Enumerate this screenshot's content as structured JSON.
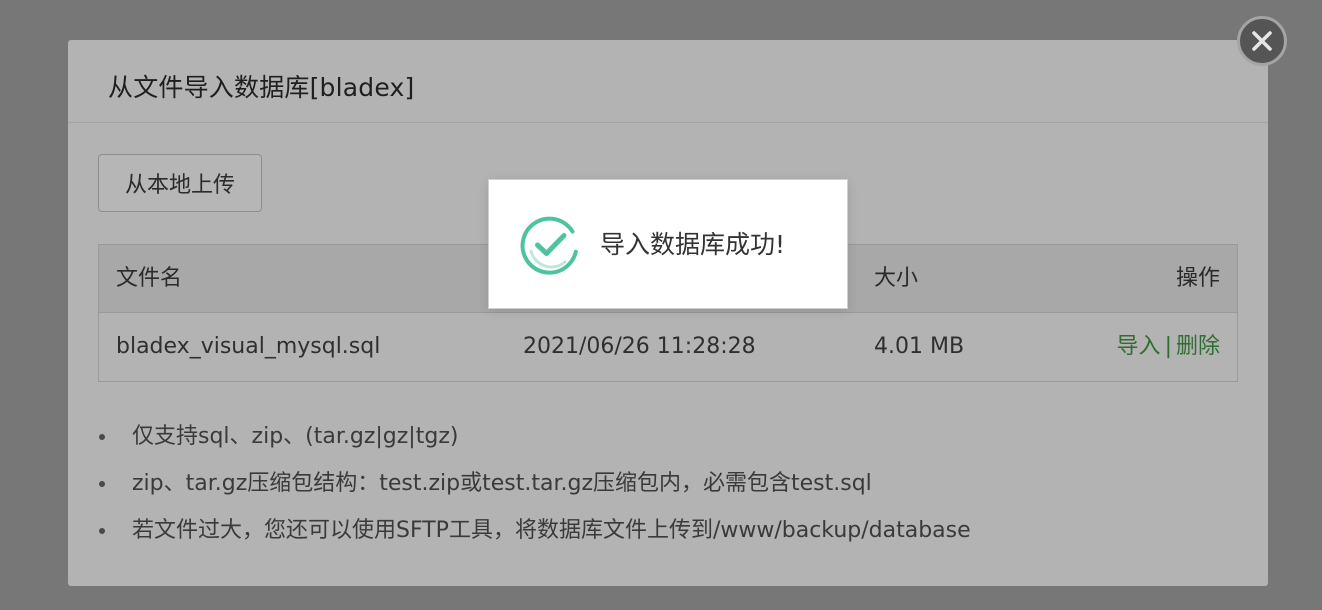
{
  "dialog": {
    "title": "从文件导入数据库[bladex]",
    "upload_label": "从本地上传"
  },
  "table": {
    "headers": {
      "name": "文件名",
      "size": "大小",
      "ops": "操作"
    },
    "rows": [
      {
        "name": "bladex_visual_mysql.sql",
        "time": "2021/06/26 11:28:28",
        "size": "4.01 MB",
        "import_label": "导入",
        "separator": "|",
        "delete_label": "删除"
      }
    ]
  },
  "tips": [
    "仅支持sql、zip、(tar.gz|gz|tgz)",
    "zip、tar.gz压缩包结构：test.zip或test.tar.gz压缩包内，必需包含test.sql",
    "若文件过大，您还可以使用SFTP工具，将数据库文件上传到/www/backup/database"
  ],
  "toast": {
    "message": "导入数据库成功!"
  },
  "icons": {
    "close": "close-icon",
    "success": "check-circle-icon",
    "bullet": "bullet-icon"
  },
  "colors": {
    "overlay": "#777777",
    "dialog_bg": "#b3b3b3",
    "link_green": "#2f6e2f",
    "success_teal": "#4fc3a1"
  }
}
